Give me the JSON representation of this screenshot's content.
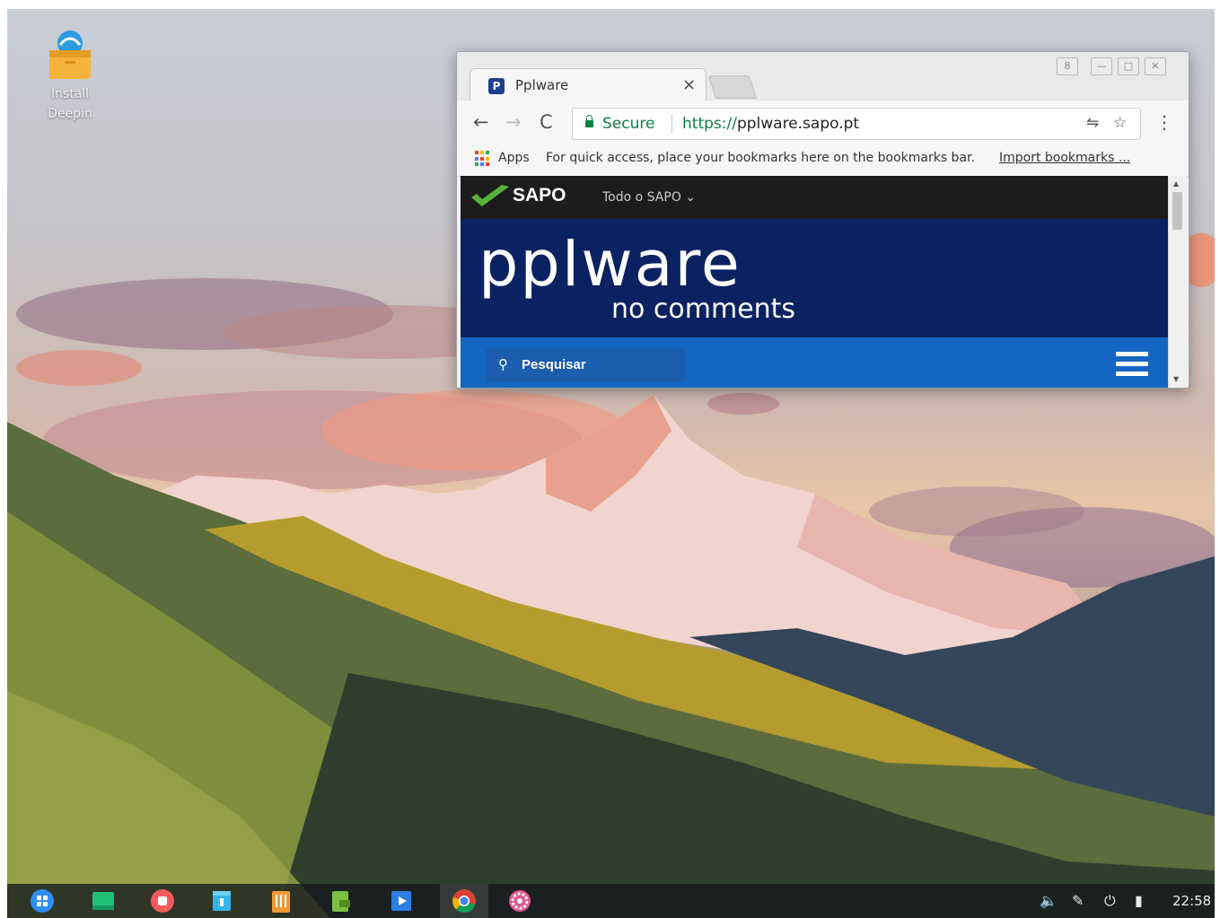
{
  "desktop": {
    "icon_label_line1": "Install",
    "icon_label_line2": "Deepin"
  },
  "browser": {
    "tab": {
      "title": "Pplware",
      "favicon_letter": "P",
      "close": "×"
    },
    "window_buttons": {
      "profile": "8",
      "minimize": "—",
      "maximize": "□",
      "close": "✕"
    },
    "toolbar": {
      "back": "←",
      "forward": "→",
      "reload": "C",
      "secure_label": "Secure",
      "url_scheme": "https://",
      "url_host": "pplware.sapo.pt",
      "translate_icon": "⇋",
      "star_icon": "☆",
      "menu": "⋮"
    },
    "bookmarks": {
      "apps_label": "Apps",
      "hint": "For quick access, place your bookmarks here on the bookmarks bar.",
      "import_link": "Import bookmarks ..."
    },
    "page": {
      "sapo_logo": "SAPO",
      "sapo_menu": "Todo o SAPO ⌄",
      "hero_title": "pplware",
      "hero_tagline": "no comments",
      "search_placeholder": "Pesquisar"
    }
  },
  "taskbar": {
    "clock": "22:58",
    "apps": [
      "launcher",
      "terminal",
      "recorder",
      "store",
      "archive",
      "document-viewer",
      "media-player",
      "chrome",
      "settings"
    ]
  },
  "colors": {
    "sapo_bar": "#1c1c1c",
    "hero_bg": "#0a2262",
    "hero_accent": "#29b6f6",
    "search_bar": "#1466c2",
    "secure_green": "#0b8043"
  }
}
